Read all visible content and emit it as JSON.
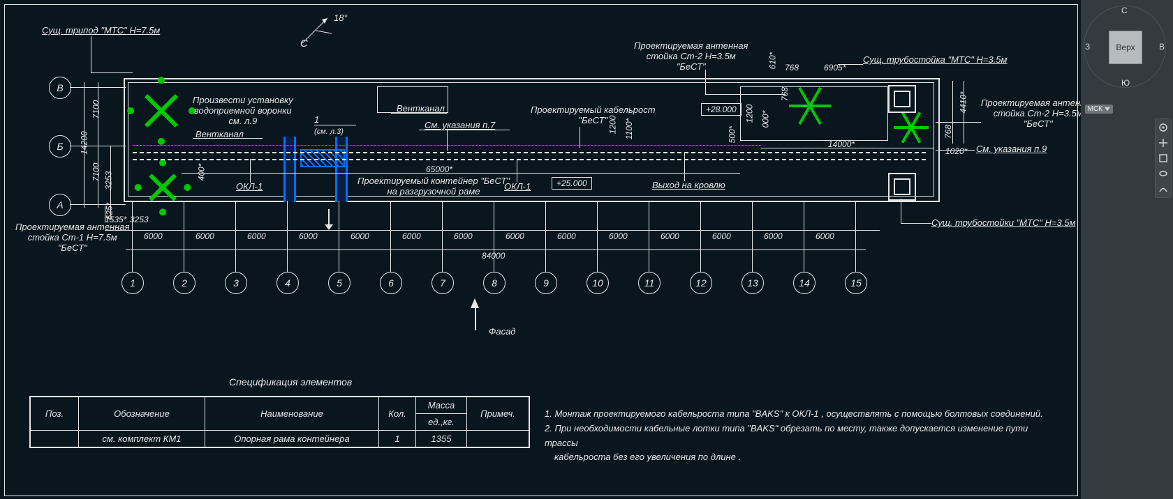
{
  "compass": {
    "angle": "18°",
    "c_letter": "С"
  },
  "axis_letters": [
    "В",
    "Б",
    "А"
  ],
  "axis_numbers": [
    "1",
    "2",
    "3",
    "4",
    "5",
    "6",
    "7",
    "8",
    "9",
    "10",
    "11",
    "12",
    "13",
    "14",
    "15"
  ],
  "dims": {
    "row_7100_top": "7100",
    "row_14200": "14200",
    "row_7100_bot": "7100",
    "row_3253": "3253",
    "row_625": "625*",
    "d1535": "1535*",
    "d3253b": "3253",
    "span": "6000",
    "total": "84000",
    "d65000": "65000*",
    "d14000": "14000*",
    "d400": "400*",
    "d1200a": "1200",
    "d1200b": "1200",
    "d1100": "1100*",
    "d500": "500*",
    "d610": "610*",
    "d768a": "768",
    "d768b": "768",
    "d6905": "6905*",
    "d1020": "1020*",
    "d4410": "4410*",
    "d000": "000*",
    "frac_num": "1",
    "frac_den": "(см. л.3)"
  },
  "labels": {
    "tripod": "Сущ. трипод \"МТС\" H=7.5м",
    "ant_st2_top": "Проектируемая антенная",
    "ant_st2_bot": "стойка Ст-2  H=3.5м",
    "ant_st2_brand": "\"БеСТ\"",
    "pipe_mts": "Сущ. трубостойка \"МТС\" H=3.5м",
    "pipe_mts_pl": "Сущ. трубостойки \"МТС\" H=3.5м",
    "ant_st1_top": "Проектируемая антенная",
    "ant_st1_bot": "стойка Ст-1  H=7.5м",
    "ant_st1_brand": "\"БеСТ\"",
    "ventkanal": "Вентканал",
    "ventkanal2": "Вентканал",
    "voronka1": "Произвести установку",
    "voronka2": "водоприемной воронки",
    "voronka3": "см. л.9",
    "p7": "См. указания п.7",
    "p9": "См. указания п.9",
    "cable_top": "Проектируемый кабельрост",
    "cable_brand": "\"БеСТ\"",
    "okl1": "ОКЛ-1",
    "okl1b": "ОКЛ-1",
    "cont_top": "Проектируемый контейнер \"БеСТ\"",
    "cont_bot": "на разгрузочной раме",
    "roof_exit": "Выход на кровлю",
    "fasad": "Фасад",
    "lvl28": "+28.000",
    "lvl25": "+25.000"
  },
  "spec": {
    "title": "Спецификация элементов",
    "headers": {
      "pos": "Поз.",
      "oboz": "Обозначение",
      "naim": "Наименование",
      "kol": "Кол.",
      "massa_top": "Масса",
      "massa_bot": "ед.,кг.",
      "prim": "Примеч."
    },
    "row1": {
      "pos": "",
      "oboz": "см. комплект КМ1",
      "naim": "Опорная рама контейнера",
      "kol": "1",
      "massa": "1355",
      "prim": ""
    }
  },
  "notes": {
    "n1": "1. Монтаж проектируемого кабельроста типа \"BAKS\" к ОКЛ-1 , осуществлять с помощью болтовых соединений.",
    "n2a": "2. При необходимости кабельные лотки типа \"BAKS\" обрезать по месту, также допускается изменение пути трассы",
    "n2b": "кабельроста без его увеличения по длине ."
  },
  "viewcube": {
    "top": "Верх",
    "n": "С",
    "s": "Ю",
    "e": "В",
    "w": "З",
    "msk": "МСК"
  }
}
